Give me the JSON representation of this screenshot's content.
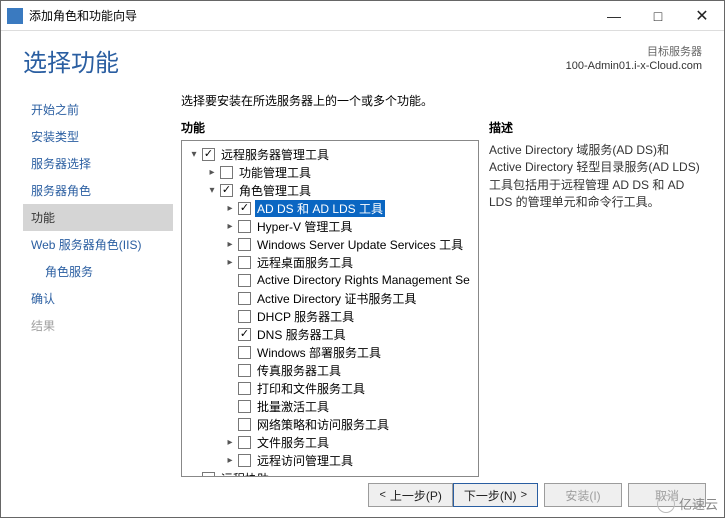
{
  "window": {
    "title": "添加角色和功能向导"
  },
  "header": {
    "heading": "选择功能",
    "target_label": "目标服务器",
    "target_value": "100-Admin01.i-x-Cloud.com"
  },
  "sidebar": {
    "steps": [
      {
        "label": "开始之前",
        "state": "normal"
      },
      {
        "label": "安装类型",
        "state": "normal"
      },
      {
        "label": "服务器选择",
        "state": "normal"
      },
      {
        "label": "服务器角色",
        "state": "normal"
      },
      {
        "label": "功能",
        "state": "active"
      },
      {
        "label": "Web 服务器角色(IIS)",
        "state": "normal"
      },
      {
        "label": "角色服务",
        "state": "normal",
        "sub": true
      },
      {
        "label": "确认",
        "state": "normal"
      },
      {
        "label": "结果",
        "state": "disabled"
      }
    ]
  },
  "main": {
    "instruction": "选择要安装在所选服务器上的一个或多个功能。",
    "features_title": "功能",
    "description_title": "描述",
    "description_text": "Active Directory 域服务(AD DS)和 Active Directory 轻型目录服务(AD LDS)工具包括用于远程管理 AD DS 和 AD LDS 的管理单元和命令行工具。"
  },
  "tree": [
    {
      "indent": 0,
      "expander": "open",
      "check": "checked",
      "label": "远程服务器管理工具"
    },
    {
      "indent": 1,
      "expander": "closed",
      "check": "none",
      "label": "功能管理工具"
    },
    {
      "indent": 1,
      "expander": "open",
      "check": "checked",
      "label": "角色管理工具"
    },
    {
      "indent": 2,
      "expander": "closed",
      "check": "checked",
      "label": "AD DS 和 AD LDS 工具",
      "selected": true
    },
    {
      "indent": 2,
      "expander": "closed",
      "check": "none",
      "label": "Hyper-V 管理工具"
    },
    {
      "indent": 2,
      "expander": "closed",
      "check": "none",
      "label": "Windows Server Update Services 工具"
    },
    {
      "indent": 2,
      "expander": "closed",
      "check": "none",
      "label": "远程桌面服务工具"
    },
    {
      "indent": 2,
      "expander": "none",
      "check": "none",
      "label": "Active Directory Rights Management Se"
    },
    {
      "indent": 2,
      "expander": "none",
      "check": "none",
      "label": "Active Directory 证书服务工具"
    },
    {
      "indent": 2,
      "expander": "none",
      "check": "none",
      "label": "DHCP 服务器工具"
    },
    {
      "indent": 2,
      "expander": "none",
      "check": "checked",
      "label": "DNS 服务器工具"
    },
    {
      "indent": 2,
      "expander": "none",
      "check": "none",
      "label": "Windows 部署服务工具"
    },
    {
      "indent": 2,
      "expander": "none",
      "check": "none",
      "label": "传真服务器工具"
    },
    {
      "indent": 2,
      "expander": "none",
      "check": "none",
      "label": "打印和文件服务工具"
    },
    {
      "indent": 2,
      "expander": "none",
      "check": "none",
      "label": "批量激活工具"
    },
    {
      "indent": 2,
      "expander": "none",
      "check": "none",
      "label": "网络策略和访问服务工具"
    },
    {
      "indent": 2,
      "expander": "closed",
      "check": "none",
      "label": "文件服务工具"
    },
    {
      "indent": 2,
      "expander": "closed",
      "check": "none",
      "label": "远程访问管理工具"
    },
    {
      "indent": 0,
      "expander": "none",
      "check": "none",
      "label": "远程协助"
    }
  ],
  "footer": {
    "previous": "上一步(P)",
    "next": "下一步(N)",
    "install": "安装(I)",
    "cancel": "取消"
  },
  "watermark": {
    "text": "亿速云"
  }
}
